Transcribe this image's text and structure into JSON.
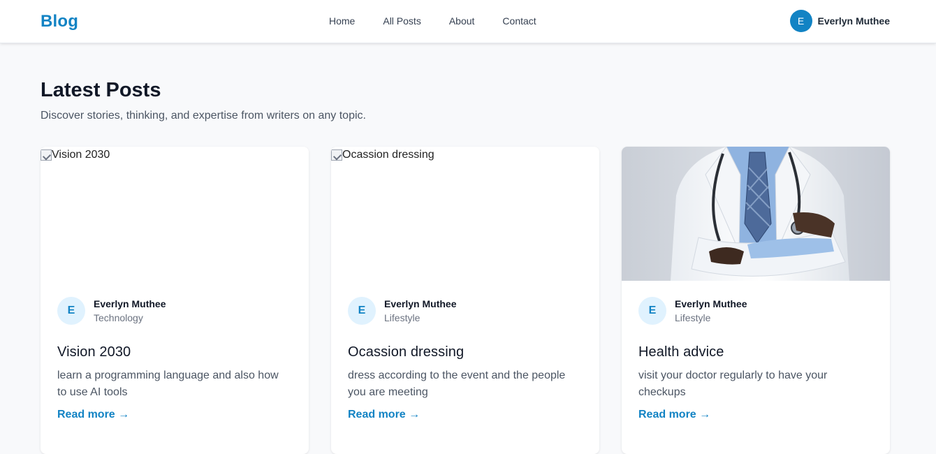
{
  "navbar": {
    "brand": "Blog",
    "links": [
      "Home",
      "All Posts",
      "About",
      "Contact"
    ],
    "user": {
      "initial": "E",
      "name": "Everlyn Muthee"
    }
  },
  "header": {
    "title": "Latest Posts",
    "subtitle": "Discover stories, thinking, and expertise from writers on any topic."
  },
  "posts": [
    {
      "image_alt": "Vision 2030",
      "author_initial": "E",
      "author": "Everlyn Muthee",
      "category": "Technology",
      "title": "Vision 2030",
      "excerpt": "learn a programming language and also how to use AI tools",
      "read_more": "Read more →"
    },
    {
      "image_alt": "Ocassion dressing",
      "author_initial": "E",
      "author": "Everlyn Muthee",
      "category": "Lifestyle",
      "title": "Ocassion dressing",
      "excerpt": "dress according to the event and the people you are meeting",
      "read_more": "Read more →"
    },
    {
      "author_initial": "E",
      "author": "Everlyn Muthee",
      "category": "Lifestyle",
      "title": "Health advice",
      "excerpt": "visit your doctor regularly to have your checkups",
      "read_more": "Read more →"
    }
  ],
  "colors": {
    "brand": "#1283c4",
    "avatar_bg": "#e0f2fe",
    "page_bg": "#f8f9fb"
  }
}
